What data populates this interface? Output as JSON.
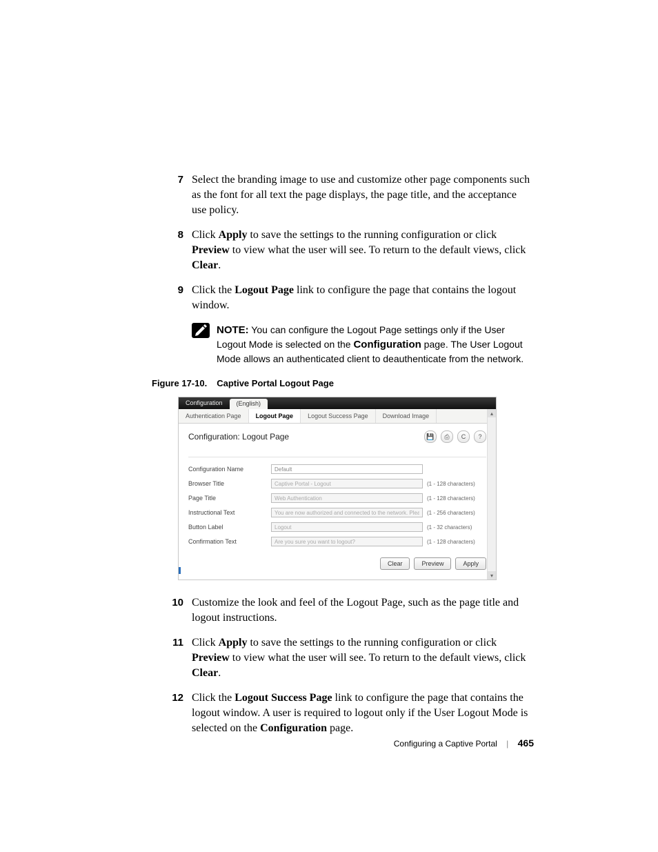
{
  "steps": {
    "s7": {
      "num": "7",
      "text": "Select the branding image to use and customize other page components such as the font for all text the page displays, the page title, and the acceptance use policy."
    },
    "s8": {
      "num": "8",
      "preText": "Click ",
      "bold1": "Apply",
      "mid1": " to save the settings to the running configuration or click ",
      "bold2": "Preview",
      "mid2": " to view what the user will see. To return to the default views, click ",
      "bold3": "Clear",
      "post": "."
    },
    "s9": {
      "num": "9",
      "preText": "Click the ",
      "bold1": "Logout Page",
      "post": " link to configure the page that contains the logout window."
    },
    "s10": {
      "num": "10",
      "text": "Customize the look and feel of the Logout Page, such as the page title and logout instructions."
    },
    "s11": {
      "num": "11",
      "preText": "Click ",
      "bold1": "Apply",
      "mid1": " to save the settings to the running configuration or click ",
      "bold2": "Preview",
      "mid2": " to view what the user will see. To return to the default views, click ",
      "bold3": "Clear",
      "post": "."
    },
    "s12": {
      "num": "12",
      "preText": "Click the ",
      "bold1": "Logout Success Page",
      "mid1": " link to configure the page that contains the logout window. A user is required to logout only if the User Logout Mode is selected on the ",
      "bold2": "Configuration",
      "post": " page."
    }
  },
  "note": {
    "label": "NOTE:",
    "pre": " You can configure the Logout Page settings only if the User Logout Mode is selected on the ",
    "bold": "Configuration",
    "post": " page. The User Logout Mode allows an authenticated client to deauthenticate from the network."
  },
  "figure": {
    "num": "Figure 17-10.",
    "title": "Captive Portal Logout Page"
  },
  "shot": {
    "topTabs": {
      "dark": "Configuration",
      "light": "(English)"
    },
    "subTabs": [
      "Authentication Page",
      "Logout Page",
      "Logout Success Page",
      "Download Image"
    ],
    "activeSubTab": 1,
    "panelTitle": "Configuration: Logout Page",
    "icons": {
      "save": "save-icon",
      "print": "print-icon",
      "refresh": "refresh-icon",
      "help": "help-icon"
    },
    "iconGlyphs": {
      "save": "💾",
      "print": "⎙",
      "refresh": "C",
      "help": "?"
    },
    "fields": [
      {
        "label": "Configuration Name",
        "value": "Default",
        "hint": "",
        "ro": false
      },
      {
        "label": "Browser Title",
        "value": "Captive Portal - Logout",
        "hint": "(1 - 128 characters)",
        "ro": true
      },
      {
        "label": "Page Title",
        "value": "Web Authentication",
        "hint": "(1 - 128 characters)",
        "ro": true
      },
      {
        "label": "Instructional Text",
        "value": "You are now authorized and connected to the network. Please retain this small logo",
        "hint": "(1 - 256 characters)",
        "ro": true
      },
      {
        "label": "Button Label",
        "value": "Logout",
        "hint": "(1 - 32 characters)",
        "ro": true
      },
      {
        "label": "Confirmation Text",
        "value": "Are you sure you want to logout?",
        "hint": "(1 - 128 characters)",
        "ro": true
      }
    ],
    "buttons": {
      "clear": "Clear",
      "preview": "Preview",
      "apply": "Apply"
    }
  },
  "footer": {
    "chapter": "Configuring a Captive Portal",
    "page": "465"
  }
}
